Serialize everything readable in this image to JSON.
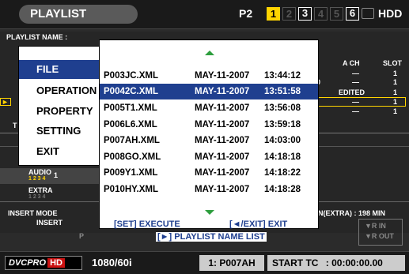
{
  "topbar": {
    "title": "PLAYLIST",
    "card_label": "P2",
    "slots": [
      "1",
      "2",
      "3",
      "4",
      "5",
      "6"
    ],
    "hdd_label": "HDD",
    "colors": {
      "active_slot": "#ffd400"
    }
  },
  "background": {
    "playlist_name_label": "PLAYLIST NAME :",
    "a_ch_label": "A CH",
    "slot_label": "SLOT",
    "a_ch_values": [
      "—",
      "—",
      "—",
      "—"
    ],
    "slot_values": [
      "1",
      "1",
      "1",
      "1",
      "1"
    ],
    "edited_label": "EDITED",
    "audio_label": "AUDIO",
    "audio_channels": "1 2 3 4",
    "audio_value": "1",
    "extra_label": "EXTRA",
    "extra_channels": "1 2 3 4",
    "insert_mode_label": "INSERT MODE",
    "insert_value": "INSERT",
    "remain_label": "N(EXTRA) : 198 MIN",
    "r_in_label": "▼R IN",
    "r_out_label": "▼R OUT",
    "p_label": "P",
    "t_label": "T",
    "row_marker": "0"
  },
  "menu": {
    "items": [
      {
        "label": "FILE",
        "selected": true
      },
      {
        "label": "OPERATION",
        "selected": false
      },
      {
        "label": "PROPERTY",
        "selected": false
      },
      {
        "label": "SETTING",
        "selected": false
      },
      {
        "label": "EXIT",
        "selected": false
      }
    ]
  },
  "dialog": {
    "files": [
      {
        "name": "P003JC.XML",
        "date": "MAY-11-2007",
        "time": "13:44:12",
        "selected": false
      },
      {
        "name": "P0042C.XML",
        "date": "MAY-11-2007",
        "time": "13:51:58",
        "selected": true
      },
      {
        "name": "P005T1.XML",
        "date": "MAY-11-2007",
        "time": "13:56:08",
        "selected": false
      },
      {
        "name": "P006L6.XML",
        "date": "MAY-11-2007",
        "time": "13:59:18",
        "selected": false
      },
      {
        "name": "P007AH.XML",
        "date": "MAY-11-2007",
        "time": "14:03:00",
        "selected": false
      },
      {
        "name": "P008GO.XML",
        "date": "MAY-11-2007",
        "time": "14:18:18",
        "selected": false
      },
      {
        "name": "P009Y1.XML",
        "date": "MAY-11-2007",
        "time": "14:18:22",
        "selected": false
      },
      {
        "name": "P010HY.XML",
        "date": "MAY-11-2007",
        "time": "14:18:28",
        "selected": false
      }
    ],
    "set_execute": "[SET] EXECUTE",
    "exit_hint": "[◄/EXIT] EXIT",
    "playlist_name_list": "[►] PLAYLIST NAME LIST",
    "colors": {
      "selection": "#1f3f8f",
      "arrow": "#2e9e3e"
    }
  },
  "bottombar": {
    "codec": "DVCPRO",
    "hd_badge": "HD",
    "format": "1080/60i",
    "clip": "1: P007AH",
    "start_tc_label": "START TC",
    "start_tc_value": ": 00:00:00.00"
  }
}
